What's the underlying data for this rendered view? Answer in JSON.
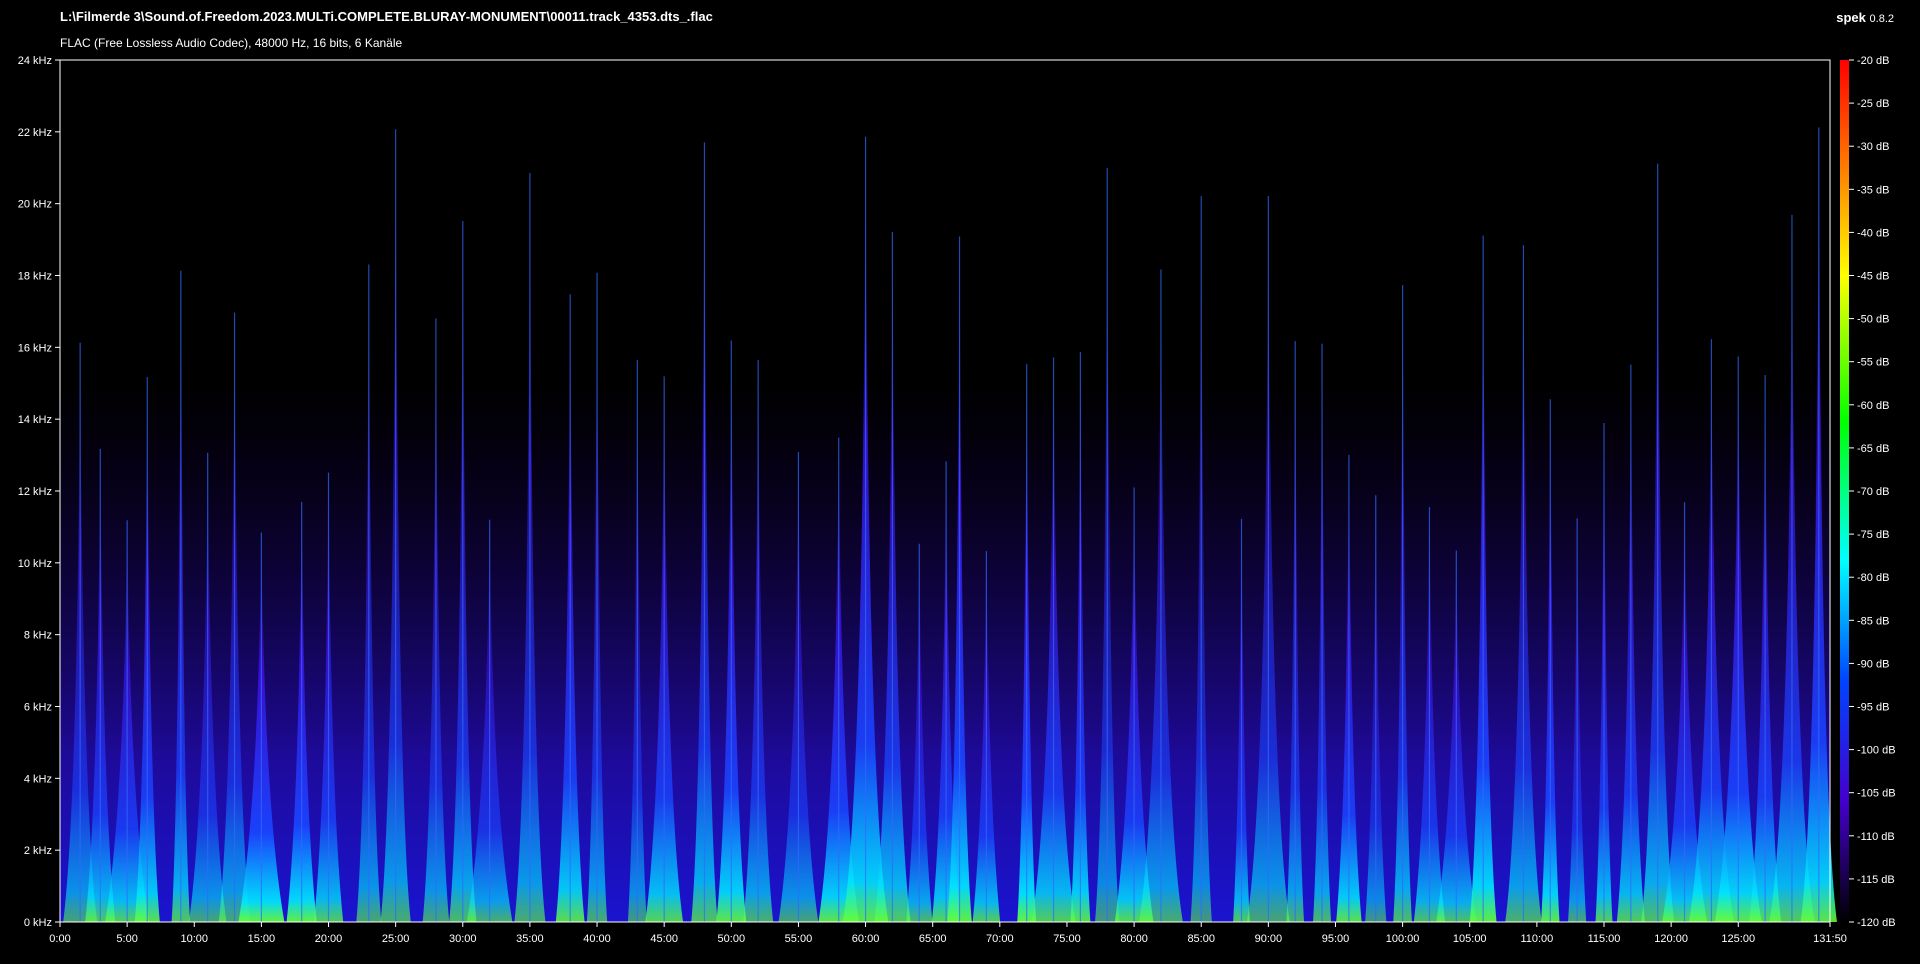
{
  "header": {
    "file_path": "L:\\Filmerde 3\\Sound.of.Freedom.2023.MULTi.COMPLETE.BLURAY-MONUMENT\\00011.track_4353.dts_.flac",
    "codec_info": "FLAC (Free Lossless Audio Codec), 48000 Hz, 16 bits, 6 Kanäle",
    "app_name": "spek",
    "app_version": "0.8.2"
  },
  "chart_data": {
    "type": "heatmap",
    "title": "",
    "xlabel": "",
    "ylabel": "",
    "x_range_minutes": [
      0,
      131.833
    ],
    "y_range_khz": [
      0,
      24
    ],
    "y_ticks": [
      "0 kHz",
      "2 kHz",
      "4 kHz",
      "6 kHz",
      "8 kHz",
      "10 kHz",
      "12 kHz",
      "14 kHz",
      "16 kHz",
      "18 kHz",
      "20 kHz",
      "22 kHz",
      "24 kHz"
    ],
    "x_ticks": [
      "0:00",
      "5:00",
      "10:00",
      "15:00",
      "20:00",
      "25:00",
      "30:00",
      "35:00",
      "40:00",
      "45:00",
      "50:00",
      "55:00",
      "60:00",
      "65:00",
      "70:00",
      "75:00",
      "80:00",
      "85:00",
      "90:00",
      "95:00",
      "100:00",
      "105:00",
      "110:00",
      "115:00",
      "120:00",
      "125:00",
      "131:50"
    ],
    "color_scale_db": [
      -20,
      -120
    ],
    "color_ticks": [
      "-20 dB",
      "-25 dB",
      "-30 dB",
      "-35 dB",
      "-40 dB",
      "-45 dB",
      "-50 dB",
      "-55 dB",
      "-60 dB",
      "-65 dB",
      "-70 dB",
      "-75 dB",
      "-80 dB",
      "-85 dB",
      "-90 dB",
      "-95 dB",
      "-100 dB",
      "-105 dB",
      "-110 dB",
      "-115 dB",
      "-120 dB"
    ],
    "colormap": [
      "#ff0000",
      "#ff8800",
      "#ffff00",
      "#00ff00",
      "#00ffff",
      "#0000ff",
      "#5500cc",
      "#000000"
    ],
    "energy_peaks_minutes": [
      1.5,
      3,
      5,
      6.5,
      9,
      11,
      13,
      15,
      18,
      20,
      23,
      25,
      28,
      30,
      32,
      35,
      38,
      40,
      43,
      45,
      48,
      50,
      52,
      55,
      58,
      60,
      62,
      64,
      66,
      67,
      69,
      72,
      74,
      76,
      78,
      80,
      82,
      85,
      88,
      90,
      92,
      94,
      96,
      98,
      100,
      102,
      104,
      106,
      109,
      111,
      113,
      115,
      117,
      119,
      121,
      123,
      125,
      127,
      129,
      131
    ]
  }
}
